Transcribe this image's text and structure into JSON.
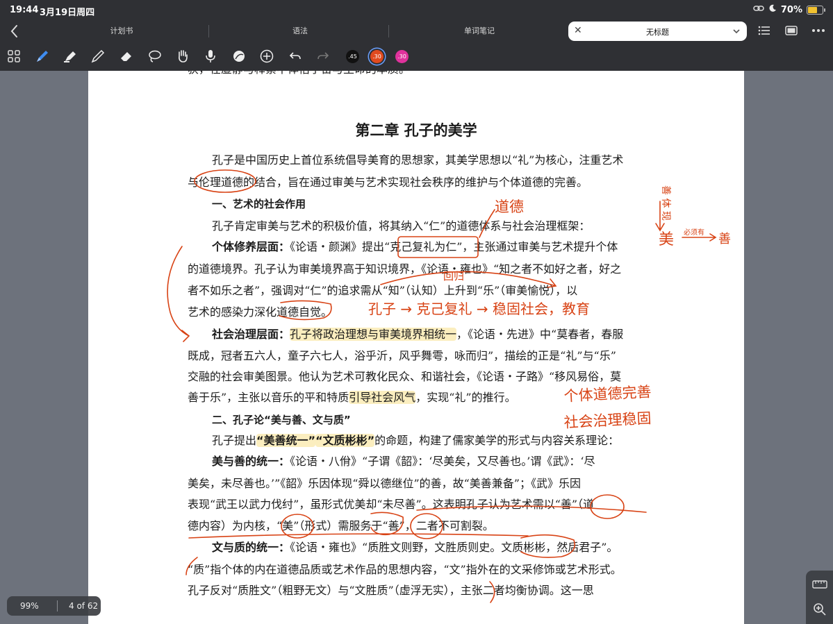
{
  "status": {
    "time": "19:44",
    "date": "3月19日周四",
    "battery": "70%",
    "battery_level": 0.7
  },
  "tabs": [
    {
      "label": "计划书"
    },
    {
      "label": "语法"
    },
    {
      "label": "单词笔记"
    }
  ],
  "active_tab": {
    "title": "无标题"
  },
  "toolbar": {
    "tools": [
      "grid-icon",
      "pen-icon",
      "highlighter-icon",
      "pencil-icon",
      "eraser-icon",
      "lasso-icon",
      "hand-icon",
      "mic-icon",
      "shape-icon",
      "add-icon",
      "undo-icon",
      "redo-icon"
    ],
    "swatches": [
      {
        "label": ".45",
        "color": "#111111"
      },
      {
        "label": ".30",
        "color": "#e04a1f"
      },
      {
        "label": ".30",
        "color": "#e0329c"
      }
    ]
  },
  "page": {
    "cut_line": "获，在虚静与释紧中体悟宇宙与生命的本质。",
    "chapter": "第二章  孔子的美学",
    "p1": {
      "l1": "孔子是中国历史上首位系统倡导美育的思想家，其美学思想以“礼”为核心，注重艺术",
      "l2": "与伦理道德的结合，旨在通过审美与艺术实现社会秩序的维护与个体道德的完善。"
    },
    "h2_1": "一、艺术的社会作用",
    "p2": "孔子肯定审美与艺术的积极价值，将其纳入“仁”的道德体系与社会治理框架：",
    "p3": {
      "label": "个体修养层面：",
      "l1_rest": "《论语・颜渊》提出“克己复礼为仁”，主张通过审美与艺术提升个体",
      "l2": "的道德境界。孔子认为审美境界高于知识境界，《论语・雍也》“知之者不如好之者，好之",
      "l3": "者不如乐之者”，强调对“仁”的追求需从“知”（认知）上升到“乐”（审美愉悦），以",
      "l4": "艺术的感染力深化道德自觉。"
    },
    "p4": {
      "label": "社会治理层面：",
      "highlight": "孔子将政治理想与审美境界相统一",
      "l1_rest": "，《论语・先进》中“莫春者，春服",
      "l2": "既成，冠者五六人，童子六七人，浴乎沂，风乎舞雩，咏而归”，描绘的正是“礼”与“乐”",
      "l3": "交融的社会审美图景。他认为艺术可教化民众、和谐社会，《论语・子路》“移风易俗，莫",
      "l4_pre": "善于乐”，主张以音乐的平和特质",
      "l4_hl": "引导社会风气",
      "l4_post": "，实现“礼”的推行。"
    },
    "h2_2": "二、孔子论“美与善、文与质”",
    "p5": {
      "pre": "孔子提出",
      "hl1": "“美善统一”",
      "hl2": "“文质彬彬”",
      "post": "的命题，构建了儒家美学的形式与内容关系理论："
    },
    "p6": {
      "label": "美与善的统一：",
      "l1_rest": "《论语・八佾》“子谓《韶》：‘尽美矣，又尽善也。’谓《武》：‘尽",
      "l2": "美矣，未尽善也。’”《韶》乐因体现“舜以德继位”的善，故“美善兼备”；《武》乐因",
      "l3": "表现“武王以武力伐纣”，虽形式优美却“未尽善”。这表明孔子认为艺术需以“善”（道",
      "l4": "德内容）为内核，“美”（形式）需服务于“善”，二者不可割裂。"
    },
    "p7": {
      "label": "文与质的统一：",
      "l1_rest": "《论语・雍也》“质胜文则野，文胜质则史。文质彬彬，然后君子”。",
      "l2": "“质”指个体的内在道德品质或艺术作品的思想内容，“文”指外在的文采修饰或艺术形式。",
      "l3": "孔子反对“质胜文”（粗野无文）与“文胜质”（虚浮无实），主张二者均衡协调。这一思"
    }
  },
  "notes": {
    "daode": "道德",
    "shan_stack": "善 体 现",
    "mei_arrow": "美",
    "mei_target": "善",
    "mei_small": "必须有",
    "huida": "回归",
    "kongzi_line": "孔子 → 克己复礼 → 稳固社会，教育",
    "geti": "个体道德完善",
    "shehui": "社会治理稳固"
  },
  "footer": {
    "zoom": "99%",
    "page_indicator": "4 of 62"
  }
}
